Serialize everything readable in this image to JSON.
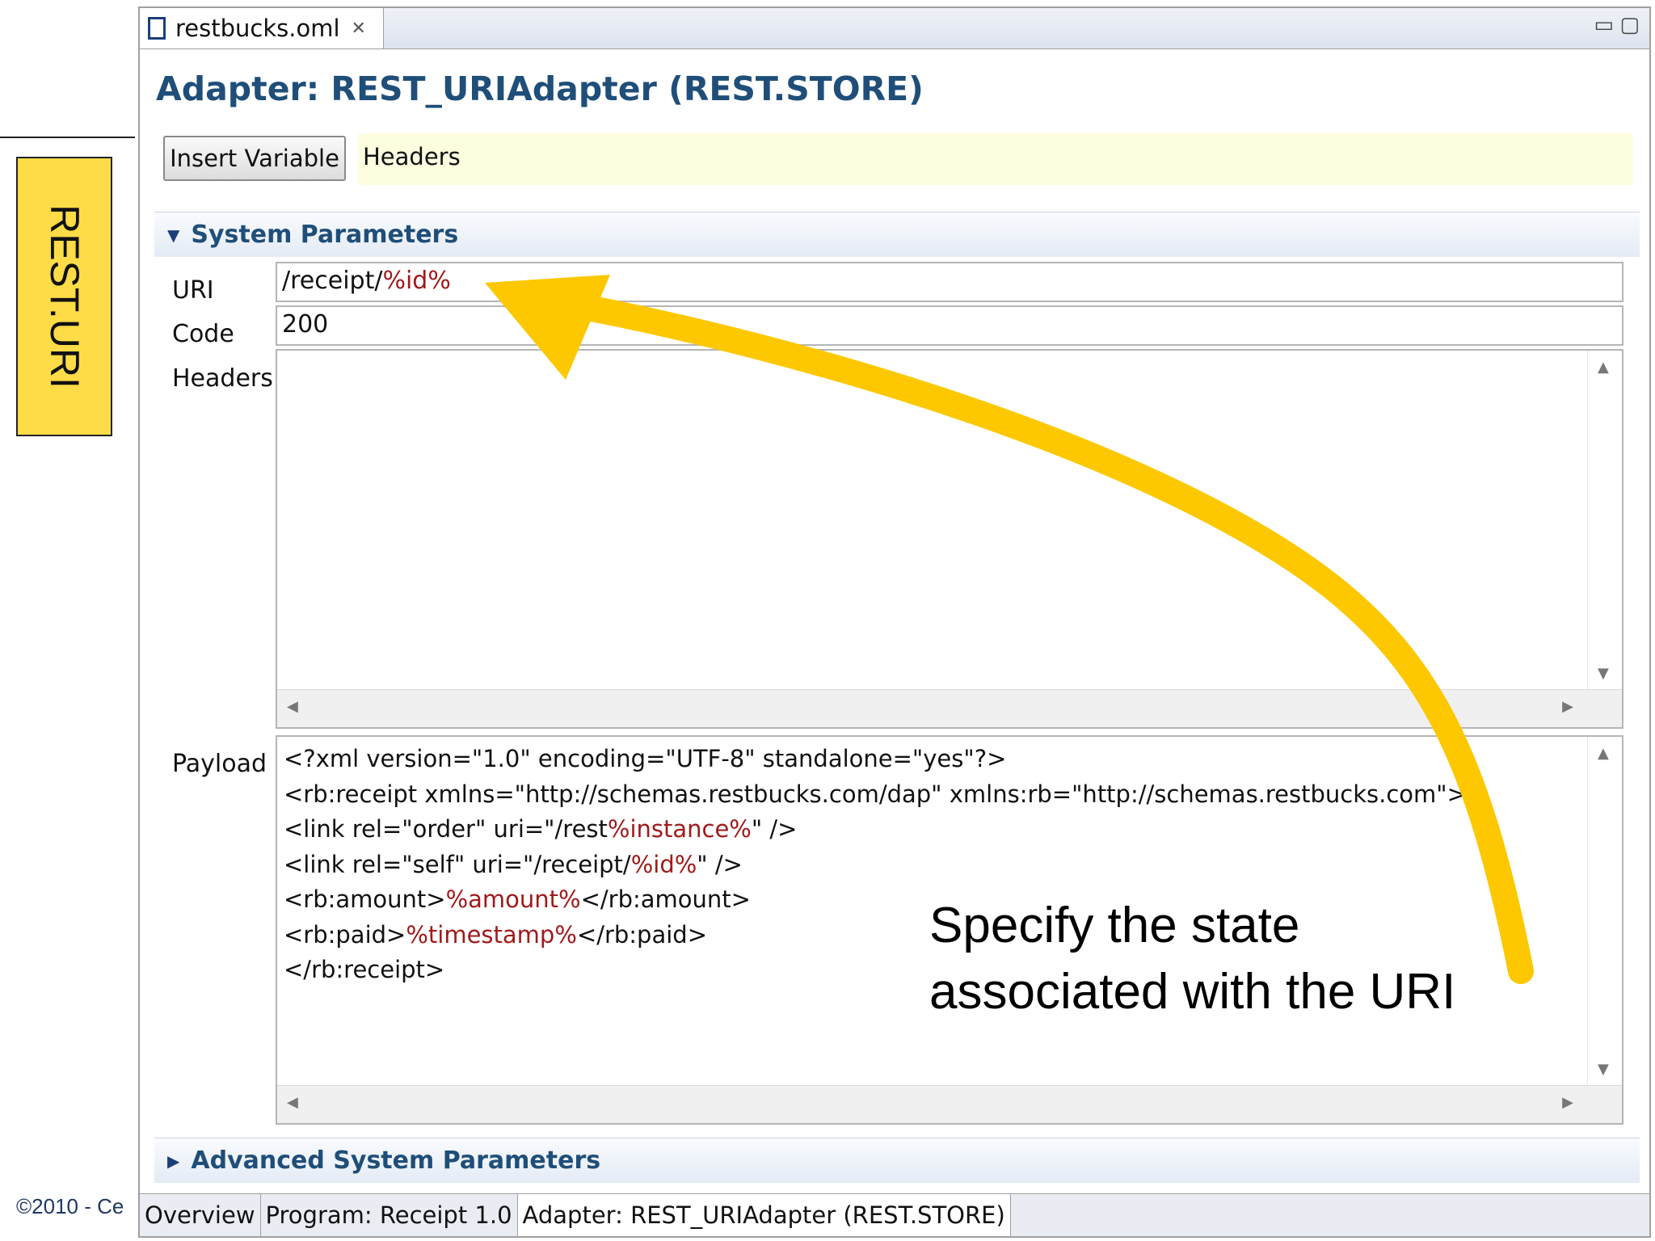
{
  "slide": {
    "side_label": "REST.URI",
    "copyright": "©2010 - Ce",
    "callout_line1": "Specify the state",
    "callout_line2": "associated with the URI",
    "accent_color": "#fddc47",
    "arrow_color": "#fdc800"
  },
  "editor": {
    "tab_label": "restbucks.oml",
    "form_title": "Adapter: REST_URIAdapter (REST.STORE)",
    "insert_variable_label": "Insert Variable",
    "headers_hint": "Headers",
    "system_section": "System Parameters",
    "advanced_section": "Advanced System Parameters",
    "fields": {
      "uri_label": "URI",
      "uri_value_plain": "/receipt/",
      "uri_value_var": "%id%",
      "code_label": "Code",
      "code_value": "200",
      "headers_label": "Headers",
      "payload_label": "Payload"
    },
    "payload": {
      "line1": "<?xml version=\"1.0\" encoding=\"UTF-8\" standalone=\"yes\"?>",
      "line2": "<rb:receipt xmlns=\"http://schemas.restbucks.com/dap\" xmlns:rb=\"http://schemas.restbucks.com\">",
      "line3_a": "<link rel=\"order\" uri=\"/rest",
      "line3_var": "%instance%",
      "line3_b": "\" />",
      "line4_a": "<link rel=\"self\" uri=\"/receipt/",
      "line4_var": "%id%",
      "line4_b": "\" />",
      "line5_a": "<rb:amount>",
      "line5_var": "%amount%",
      "line5_b": "</rb:amount>",
      "line6_a": "<rb:paid>",
      "line6_var": "%timestamp%",
      "line6_b": "</rb:paid>",
      "line7": "</rb:receipt>"
    },
    "bottom_tabs": {
      "overview": "Overview",
      "program": "Program: Receipt 1.0",
      "adapter": "Adapter: REST_URIAdapter (REST.STORE)"
    },
    "variable_color": "#a01a1a",
    "title_color": "#1f4e79"
  }
}
